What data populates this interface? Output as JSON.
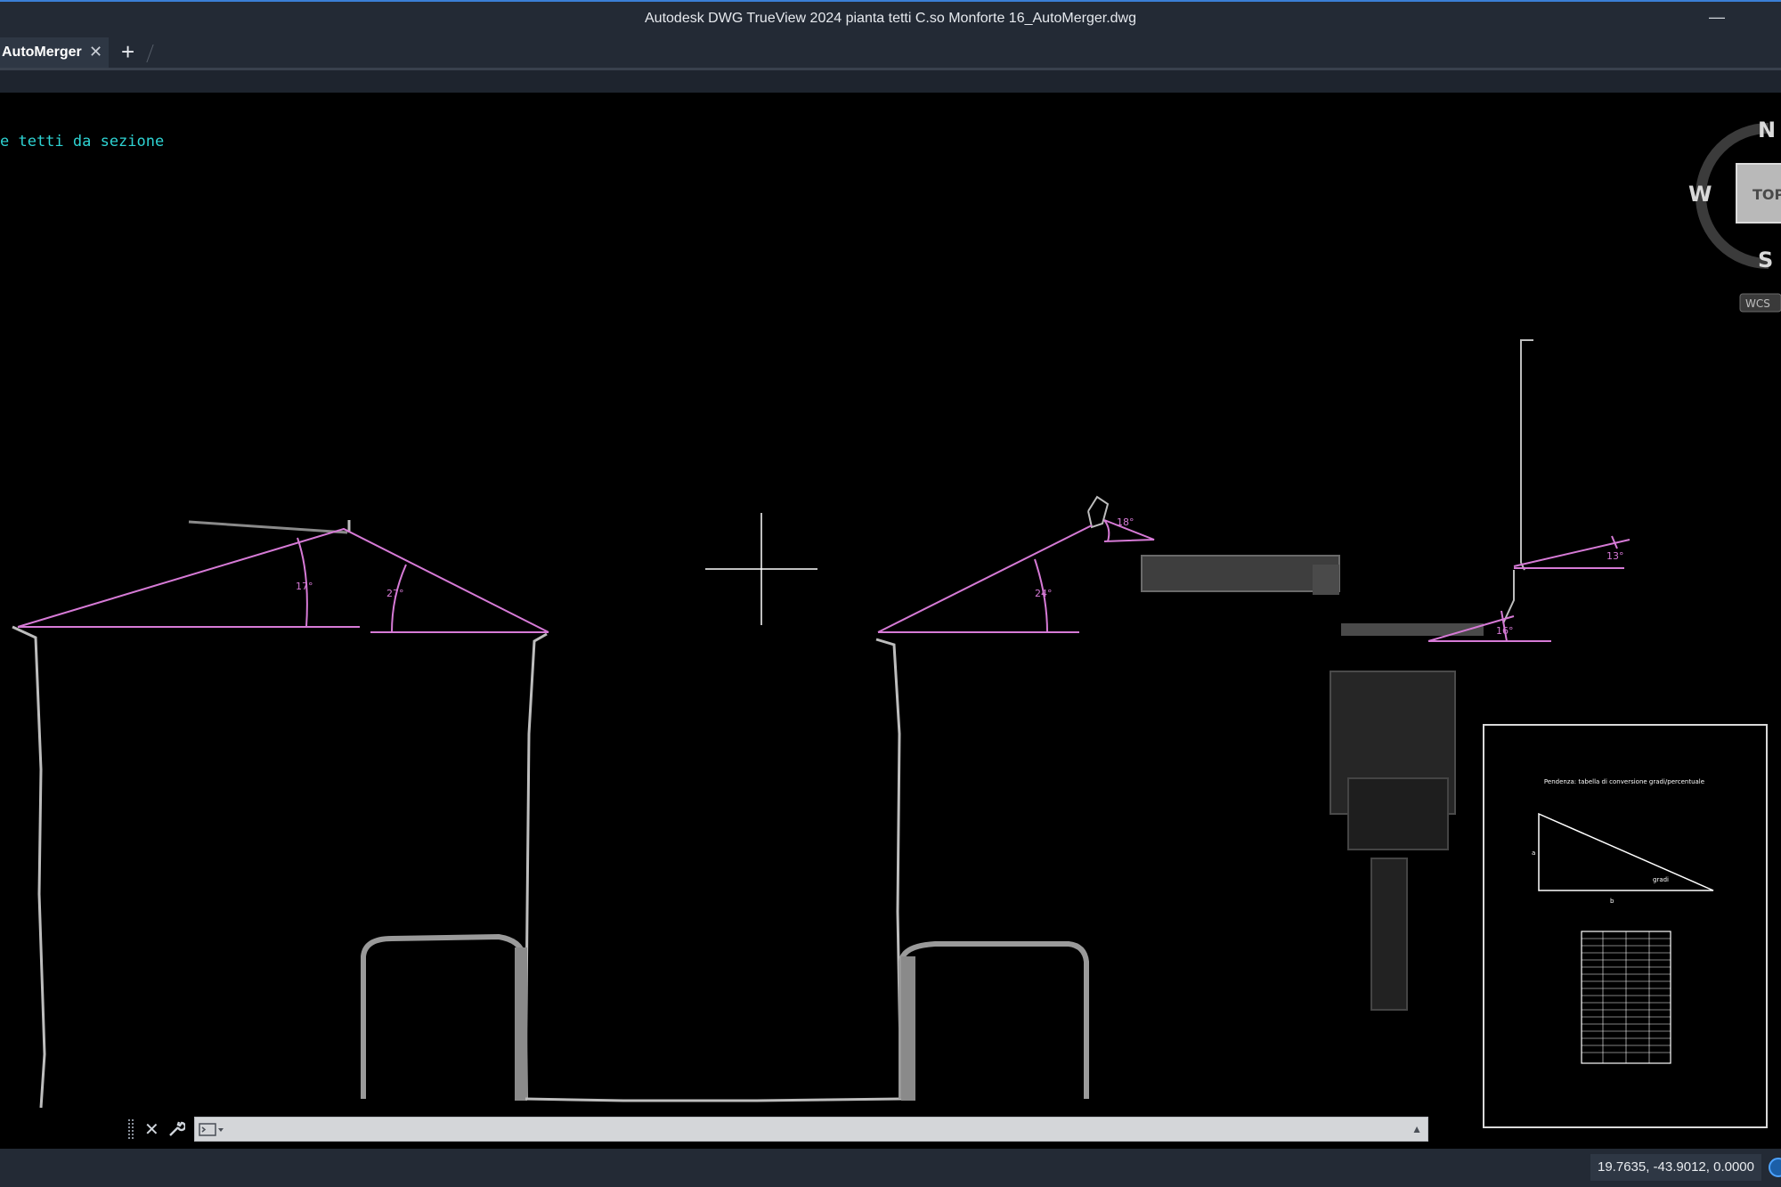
{
  "window": {
    "title": "Autodesk DWG TrueView 2024    pianta tetti C.so Monforte 16_AutoMerger.dwg",
    "minimize_glyph": "—"
  },
  "tabs": {
    "active_label": "AutoMerger",
    "close_glyph": "✕",
    "new_tab_glyph": "+"
  },
  "drawing": {
    "layer_label": "e tetti da sezione",
    "angles": [
      "17°",
      "27°",
      "24°",
      "18°",
      "13°",
      "16°"
    ],
    "legend_title": "Pendenza: tabella di conversione gradi/percentuale",
    "legend_triangle_label": "gradi",
    "legend_side_a": "a",
    "legend_side_b": "b",
    "line_color": "#d67ad6",
    "label_color": "#2ed3d3"
  },
  "viewcube": {
    "north": "N",
    "west": "W",
    "south": "S",
    "face": "TOP",
    "wcs": "WCS"
  },
  "command_line": {
    "close_glyph": "✕",
    "expand_glyph": "▲"
  },
  "status": {
    "coordinates": "19.7635, -43.9012, 0.0000"
  }
}
